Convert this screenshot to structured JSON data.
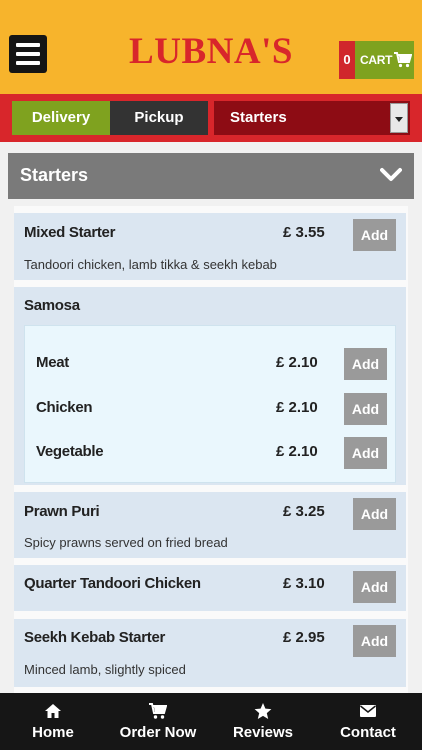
{
  "header": {
    "logo": "LUBNA'S",
    "cart_count": "0",
    "cart_label": "CART"
  },
  "tabs": {
    "delivery": "Delivery",
    "pickup": "Pickup",
    "category_selected": "Starters"
  },
  "section": {
    "title": "Starters"
  },
  "items": [
    {
      "name": "Mixed Starter",
      "price": "£ 3.55",
      "description": "Tandoori chicken, lamb tikka & seekh kebab",
      "add_label": "Add"
    },
    {
      "name": "Samosa",
      "variants": [
        {
          "name": "Meat",
          "price": "£ 2.10",
          "add_label": "Add"
        },
        {
          "name": "Chicken",
          "price": "£ 2.10",
          "add_label": "Add"
        },
        {
          "name": "Vegetable",
          "price": "£ 2.10",
          "add_label": "Add"
        }
      ]
    },
    {
      "name": "Prawn Puri",
      "price": "£ 3.25",
      "description": "Spicy prawns served on fried bread",
      "add_label": "Add"
    },
    {
      "name": "Quarter Tandoori Chicken",
      "price": "£ 3.10",
      "add_label": "Add"
    },
    {
      "name": "Seekh Kebab Starter",
      "price": "£ 2.95",
      "description": "Minced lamb, slightly spiced",
      "add_label": "Add"
    }
  ],
  "bottom_nav": [
    {
      "label": "Home",
      "icon": "home-icon"
    },
    {
      "label": "Order Now",
      "icon": "cart-icon"
    },
    {
      "label": "Reviews",
      "icon": "star-icon"
    },
    {
      "label": "Contact",
      "icon": "envelope-icon"
    }
  ],
  "colors": {
    "header_bg": "#f7b42c",
    "brand_red": "#d8262b",
    "accent_green": "#7fa21f",
    "item_bg": "#dbe6f1"
  }
}
